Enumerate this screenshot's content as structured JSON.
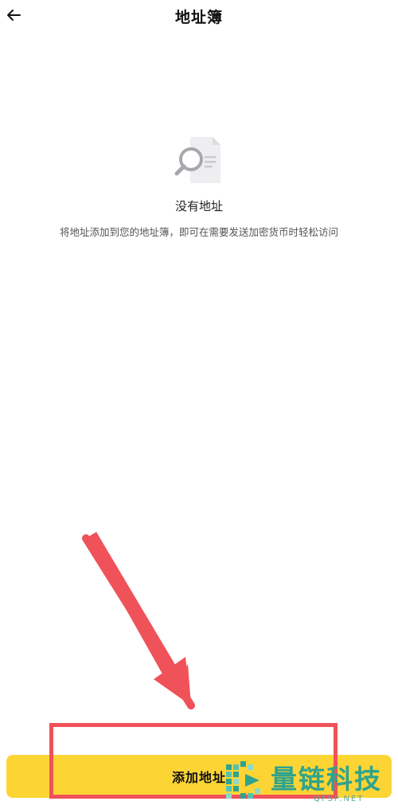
{
  "header": {
    "title": "地址簿",
    "back_icon": "arrow-left-icon"
  },
  "empty_state": {
    "icon": "document-search-icon",
    "title": "没有地址",
    "description": "将地址添加到您的地址簿，即可在需要发送加密货币时轻松访问"
  },
  "actions": {
    "add_address_label": "添加地址"
  },
  "watermark": {
    "brand": "量链科技",
    "domain": "QFSP.NET"
  },
  "colors": {
    "primary_button": "#FCD535",
    "annotation": "#F0525A",
    "watermark": "#2FA38E"
  }
}
